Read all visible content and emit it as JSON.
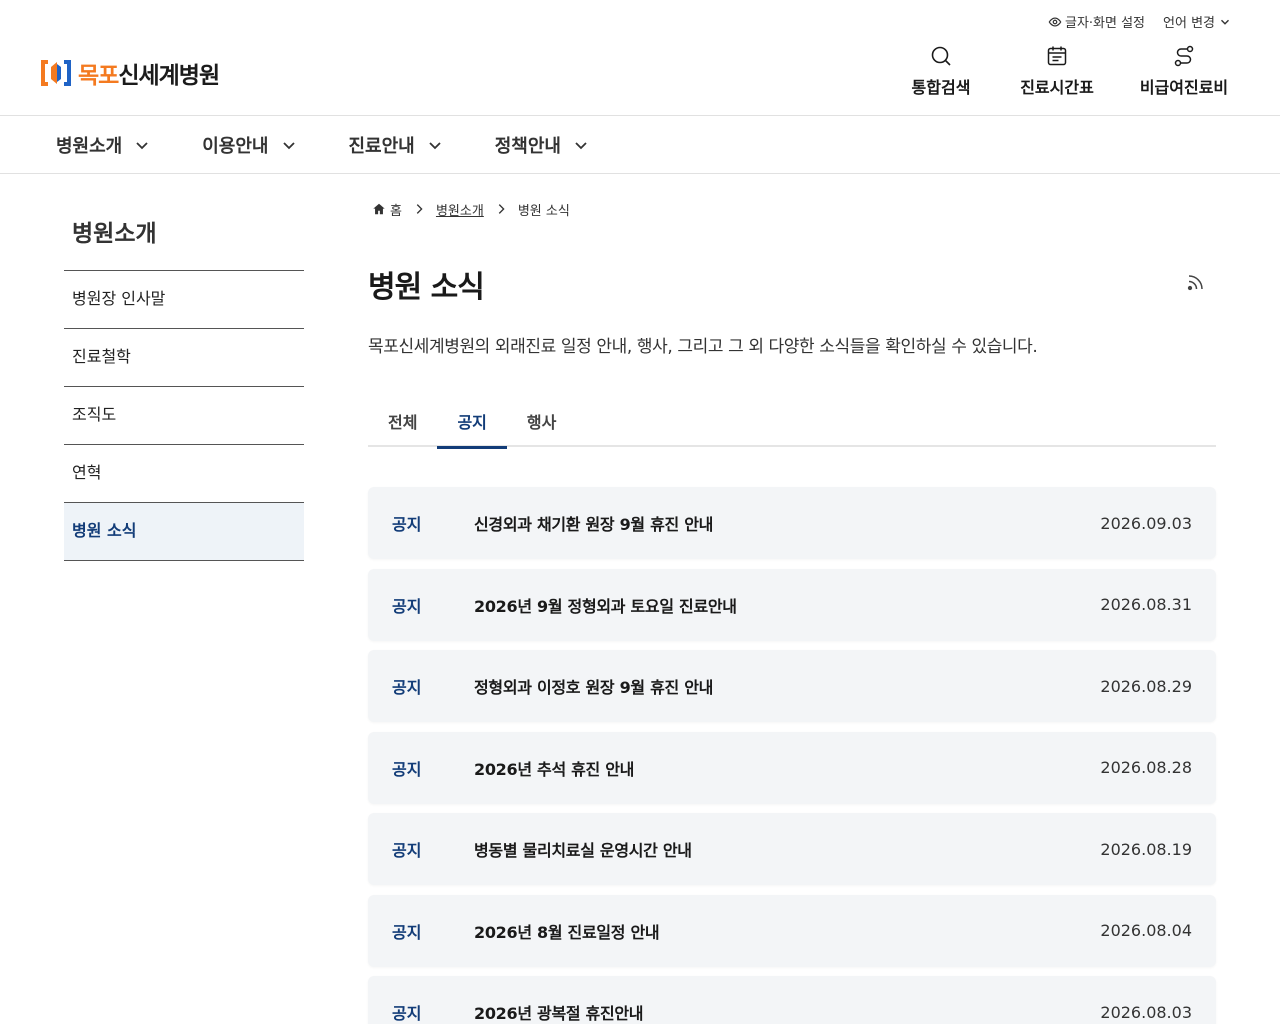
{
  "util": {
    "text_settings": "글자·화면 설정",
    "language": "언어 변경"
  },
  "logo": {
    "part1": "목포",
    "part2": "신세계병원"
  },
  "quick": [
    {
      "label": "통합검색",
      "icon": "search-icon"
    },
    {
      "label": "진료시간표",
      "icon": "calendar-icon"
    },
    {
      "label": "비급여진료비",
      "icon": "route-icon"
    }
  ],
  "gnb": [
    "병원소개",
    "이용안내",
    "진료안내",
    "정책안내"
  ],
  "lnb": {
    "title": "병원소개",
    "items": [
      "병원장 인사말",
      "진료철학",
      "조직도",
      "연혁",
      "병원 소식"
    ],
    "active": "병원 소식"
  },
  "breadcrumb": {
    "home": "홈",
    "level1": "병원소개",
    "level2": "병원 소식"
  },
  "page": {
    "title": "병원 소식",
    "description": "목포신세계병원의 외래진료 일정 안내, 행사, 그리고 그 외 다양한 소식들을 확인하실 수 있습니다."
  },
  "tabs": [
    "전체",
    "공지",
    "행사"
  ],
  "active_tab": "공지",
  "posts": [
    {
      "category": "공지",
      "subject": "신경외과 채기환 원장 9월 휴진 안내",
      "date": "2026.09.03"
    },
    {
      "category": "공지",
      "subject": "2026년 9월 정형외과 토요일 진료안내",
      "date": "2026.08.31"
    },
    {
      "category": "공지",
      "subject": "정형외과 이정호 원장 9월 휴진 안내",
      "date": "2026.08.29"
    },
    {
      "category": "공지",
      "subject": "2026년 추석 휴진 안내",
      "date": "2026.08.28"
    },
    {
      "category": "공지",
      "subject": "병동별 물리치료실 운영시간 안내",
      "date": "2026.08.19"
    },
    {
      "category": "공지",
      "subject": "2026년 8월 진료일정 안내",
      "date": "2026.08.04"
    },
    {
      "category": "공지",
      "subject": "2026년 광복절 휴진안내",
      "date": "2026.08.03"
    }
  ],
  "colors": {
    "brand_orange": "#f47a20",
    "brand_blue": "#1f63c6",
    "accent_navy": "#123c78",
    "row_bg": "#f3f5f7"
  }
}
